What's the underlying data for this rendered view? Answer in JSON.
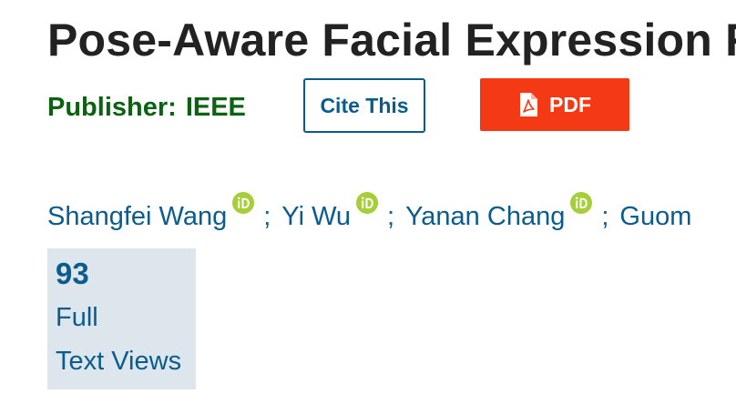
{
  "article": {
    "title": "Pose-Aware Facial Expression Recognition"
  },
  "publisher": {
    "label": "Publisher:",
    "name": "IEEE"
  },
  "actions": {
    "cite_label": "Cite This",
    "pdf_label": "PDF"
  },
  "authors": [
    {
      "name": "Shangfei Wang",
      "icon": "orcid-icon"
    },
    {
      "name": "Yi Wu",
      "icon": "orcid-icon"
    },
    {
      "name": "Yanan Chang",
      "icon": "orcid-icon"
    },
    {
      "name": "Guom"
    }
  ],
  "separator": ";",
  "metrics": {
    "count": "93",
    "label_line1": "Full",
    "label_line2": "Text Views"
  },
  "colors": {
    "link_blue": "#0a5c8c",
    "publisher_green": "#0b6311",
    "pdf_red": "#f43a15",
    "orcid_green": "#a6ce39",
    "metric_bg": "#dce6ec"
  }
}
